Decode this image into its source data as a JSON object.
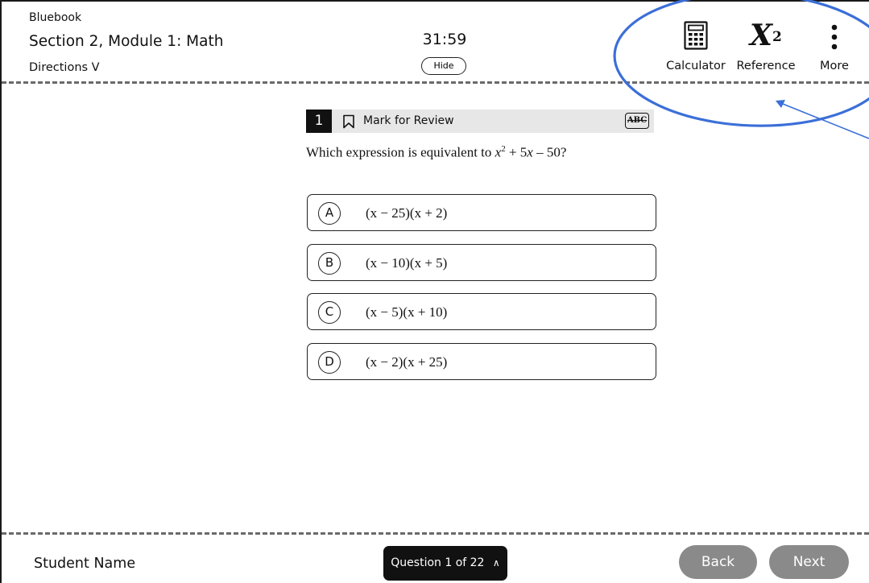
{
  "header": {
    "brand": "Bluebook",
    "section_title": "Section 2, Module 1: Math",
    "directions_label": "Directions",
    "directions_chevron": "V",
    "timer": "31:59",
    "hide_label": "Hide"
  },
  "toolbar": {
    "calculator_label": "Calculator",
    "reference_label": "Reference",
    "more_label": "More",
    "reference_icon_base": "X",
    "reference_icon_exp": "2"
  },
  "question": {
    "number": "1",
    "mark_for_review_label": "Mark for Review",
    "abc_label": "ABC",
    "stem_prefix": "Which expression is equivalent to ",
    "stem_var_x": "x",
    "stem_exp": "2",
    "stem_mid": " + 5",
    "stem_var_x2": "x",
    "stem_suffix": " – 50?",
    "choices": [
      {
        "letter": "A",
        "expression": "(x − 25)(x + 2)"
      },
      {
        "letter": "B",
        "expression": "(x − 10)(x + 5)"
      },
      {
        "letter": "C",
        "expression": "(x − 5)(x + 10)"
      },
      {
        "letter": "D",
        "expression": "(x − 2)(x + 25)"
      }
    ]
  },
  "footer": {
    "student_name": "Student Name",
    "question_nav_label": "Question 1 of 22",
    "question_nav_caret": "∧",
    "back_label": "Back",
    "next_label": "Next"
  },
  "colors": {
    "annotation_blue": "#3b6fd8",
    "nav_button_gray": "#8a8a8a",
    "dark": "#111111"
  },
  "icons": [
    "calculator-icon",
    "reference-x-squared-icon",
    "more-vertical-icon",
    "bookmark-icon",
    "abc-strikethrough-icon"
  ]
}
